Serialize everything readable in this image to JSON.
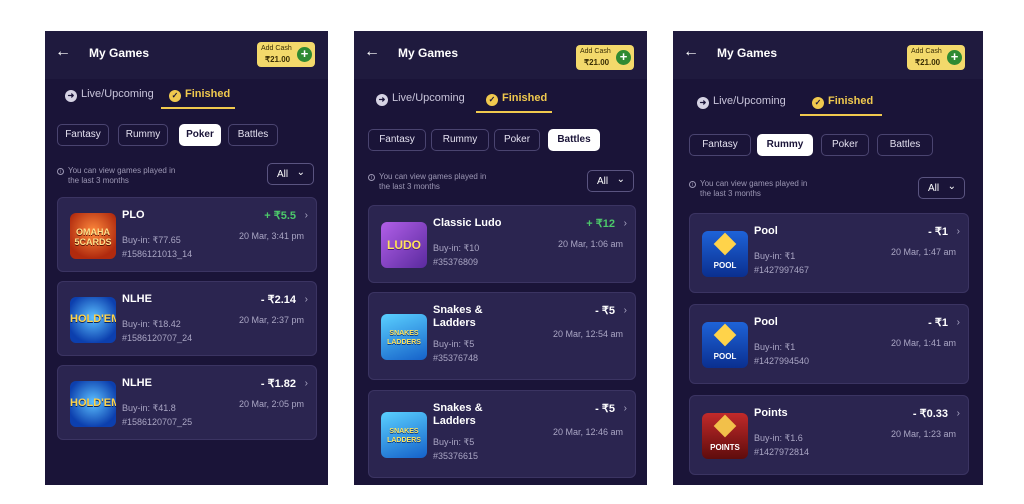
{
  "header": {
    "back_icon": "←",
    "title": "My Games",
    "add_cash_label": "Add Cash",
    "add_cash_amount": "₹21.00",
    "add_cash_plus": "+"
  },
  "tabs": {
    "live": "Live/Upcoming",
    "finished": "Finished",
    "live_icon": "arrow-right-circle-icon",
    "finished_icon": "check-circle-icon"
  },
  "categories": [
    "Fantasy",
    "Rummy",
    "Poker",
    "Battles"
  ],
  "info_text": "You can view games played in the last 3 months",
  "filter": {
    "value": "All",
    "chevron": "⌄"
  },
  "colors": {
    "background": "#1a1438",
    "card": "#2b2550",
    "accent": "#f0c94e",
    "positive": "#4cc96a",
    "add_cash": "#f3d96b"
  },
  "panels": [
    {
      "active_category": "Poker",
      "games": [
        {
          "icon": "omaha-5-cards",
          "icon_text": "OMAHA 5CARDS",
          "name": "PLO",
          "amount": "+ ₹5.5",
          "buyin": "Buy-in: ₹77.65",
          "id": "#1586121013_14",
          "date": "20 Mar, 3:41 pm"
        },
        {
          "icon": "holdem",
          "icon_text": "HOLD'EM",
          "name": "NLHE",
          "amount": "- ₹2.14",
          "buyin": "Buy-in: ₹18.42",
          "id": "#1586120707_24",
          "date": "20 Mar, 2:37 pm"
        },
        {
          "icon": "holdem",
          "icon_text": "HOLD'EM",
          "name": "NLHE",
          "amount": "- ₹1.82",
          "buyin": "Buy-in: ₹41.8",
          "id": "#1586120707_25",
          "date": "20 Mar, 2:05 pm"
        }
      ]
    },
    {
      "active_category": "Battles",
      "games": [
        {
          "icon": "ludo",
          "icon_text": "LUDO",
          "name": "Classic Ludo",
          "amount": "+ ₹12",
          "buyin": "Buy-in: ₹10",
          "id": "#35376809",
          "date": "20 Mar, 1:06 am"
        },
        {
          "icon": "snakes-ladders",
          "icon_text": "SNAKES LADDERS",
          "name": "Snakes & Ladders",
          "amount": "- ₹5",
          "buyin": "Buy-in: ₹5",
          "id": "#35376748",
          "date": "20 Mar, 12:54 am"
        },
        {
          "icon": "snakes-ladders",
          "icon_text": "SNAKES LADDERS",
          "name": "Snakes & Ladders",
          "amount": "- ₹5",
          "buyin": "Buy-in: ₹5",
          "id": "#35376615",
          "date": "20 Mar, 12:46 am"
        }
      ]
    },
    {
      "active_category": "Rummy",
      "games": [
        {
          "icon": "pool",
          "icon_text": "POOL",
          "name": "Pool",
          "amount": "- ₹1",
          "buyin": "Buy-in: ₹1",
          "id": "#1427997467",
          "date": "20 Mar, 1:47 am"
        },
        {
          "icon": "pool",
          "icon_text": "POOL",
          "name": "Pool",
          "amount": "- ₹1",
          "buyin": "Buy-in: ₹1",
          "id": "#1427994540",
          "date": "20 Mar, 1:41 am"
        },
        {
          "icon": "points",
          "icon_text": "POINTS",
          "name": "Points",
          "amount": "- ₹0.33",
          "buyin": "Buy-in: ₹1.6",
          "id": "#1427972814",
          "date": "20 Mar, 1:23 am"
        }
      ]
    }
  ]
}
